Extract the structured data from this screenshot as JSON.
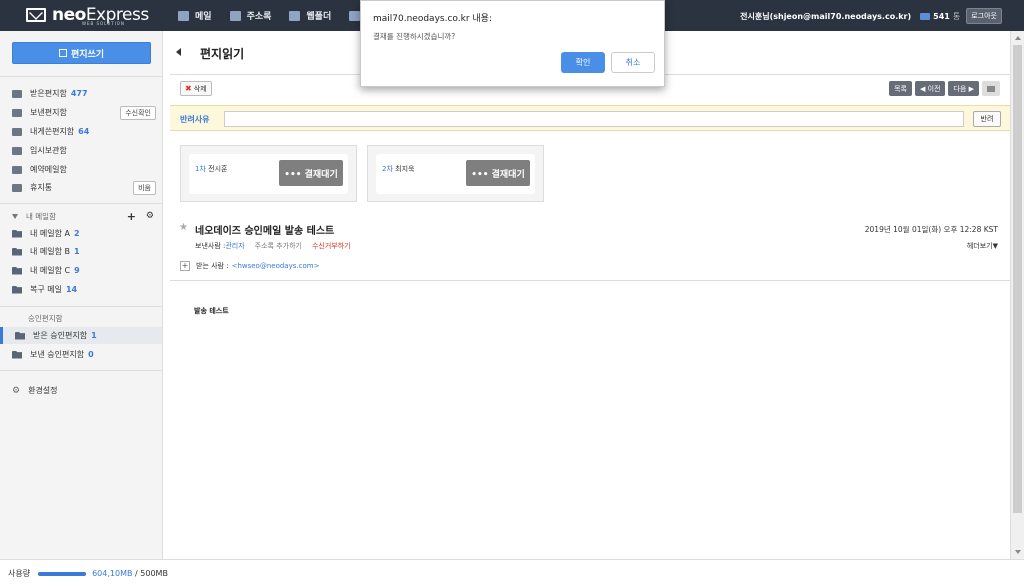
{
  "header": {
    "brand_bold": "neo",
    "brand_rest": "Express",
    "brand_sub": "WEB SOLUTION",
    "nav": [
      {
        "label": "메일",
        "icon": "mail-icon"
      },
      {
        "label": "주소록",
        "icon": "addressbook-icon"
      },
      {
        "label": "웹폴더",
        "icon": "webfolder-icon"
      }
    ],
    "user": "전시훈님(shjeon@mail70.neodays.co.kr)",
    "mail_count": "541",
    "mail_unit": "통",
    "logout_label": "로그아웃"
  },
  "sidebar": {
    "write_label": "편지쓰기",
    "folders": [
      {
        "label": "받은편지함",
        "count": "477"
      },
      {
        "label": "보낸편지함",
        "count": "",
        "action": "수신확인"
      },
      {
        "label": "내게쓴편지함",
        "count": "64"
      },
      {
        "label": "임시보관함",
        "count": ""
      },
      {
        "label": "예약메일함",
        "count": ""
      },
      {
        "label": "휴지통",
        "count": "",
        "action": "비움"
      }
    ],
    "my_section": "내 메일함",
    "my_folders": [
      {
        "label": "내 메일함 A",
        "count": "2"
      },
      {
        "label": "내 메일함 B",
        "count": "1"
      },
      {
        "label": "내 메일함 C",
        "count": "9"
      },
      {
        "label": "복구 메일",
        "count": "14"
      }
    ],
    "approval_section": "승인편지함",
    "approval_folders": [
      {
        "label": "받은 승인편지함",
        "count": "1"
      },
      {
        "label": "보낸 승인편지함",
        "count": "0"
      }
    ],
    "settings_label": "환경설정",
    "usage_label": "사용량",
    "usage_used": "604,10MB",
    "usage_total": "/ 500MB"
  },
  "main": {
    "title": "편지읽기",
    "delete_label": "삭제",
    "list_label": "목록",
    "prev_label": "이전",
    "next_label": "다음",
    "reject_label": "반려사유",
    "reject_value": "",
    "reject_button": "반려",
    "approvals": [
      {
        "step": "1차",
        "name": "전시훈",
        "status": "••• 결재대기"
      },
      {
        "step": "2차",
        "name": "최지욱",
        "status": "••• 결재대기"
      }
    ],
    "subject": "네오데이즈 승인메일 발송 테스트",
    "date": "2019년 10월 01일(화) 오후 12:28 KST",
    "sender_label": "보낸사람 : ",
    "sender_name": "관리자",
    "add_contact": "주소록 추가하기",
    "block_label": "수신거부하기",
    "header_toggle": "헤더보기▼",
    "to_label": "받는 사람 : ",
    "to_addr": "<hwseo@neodays.com>",
    "body": "발송 테스트"
  },
  "dialog": {
    "host": "mail70.neodays.co.kr 내용:",
    "message": "결재를 진행하시겠습니까?",
    "ok_label": "확인",
    "cancel_label": "취소"
  }
}
